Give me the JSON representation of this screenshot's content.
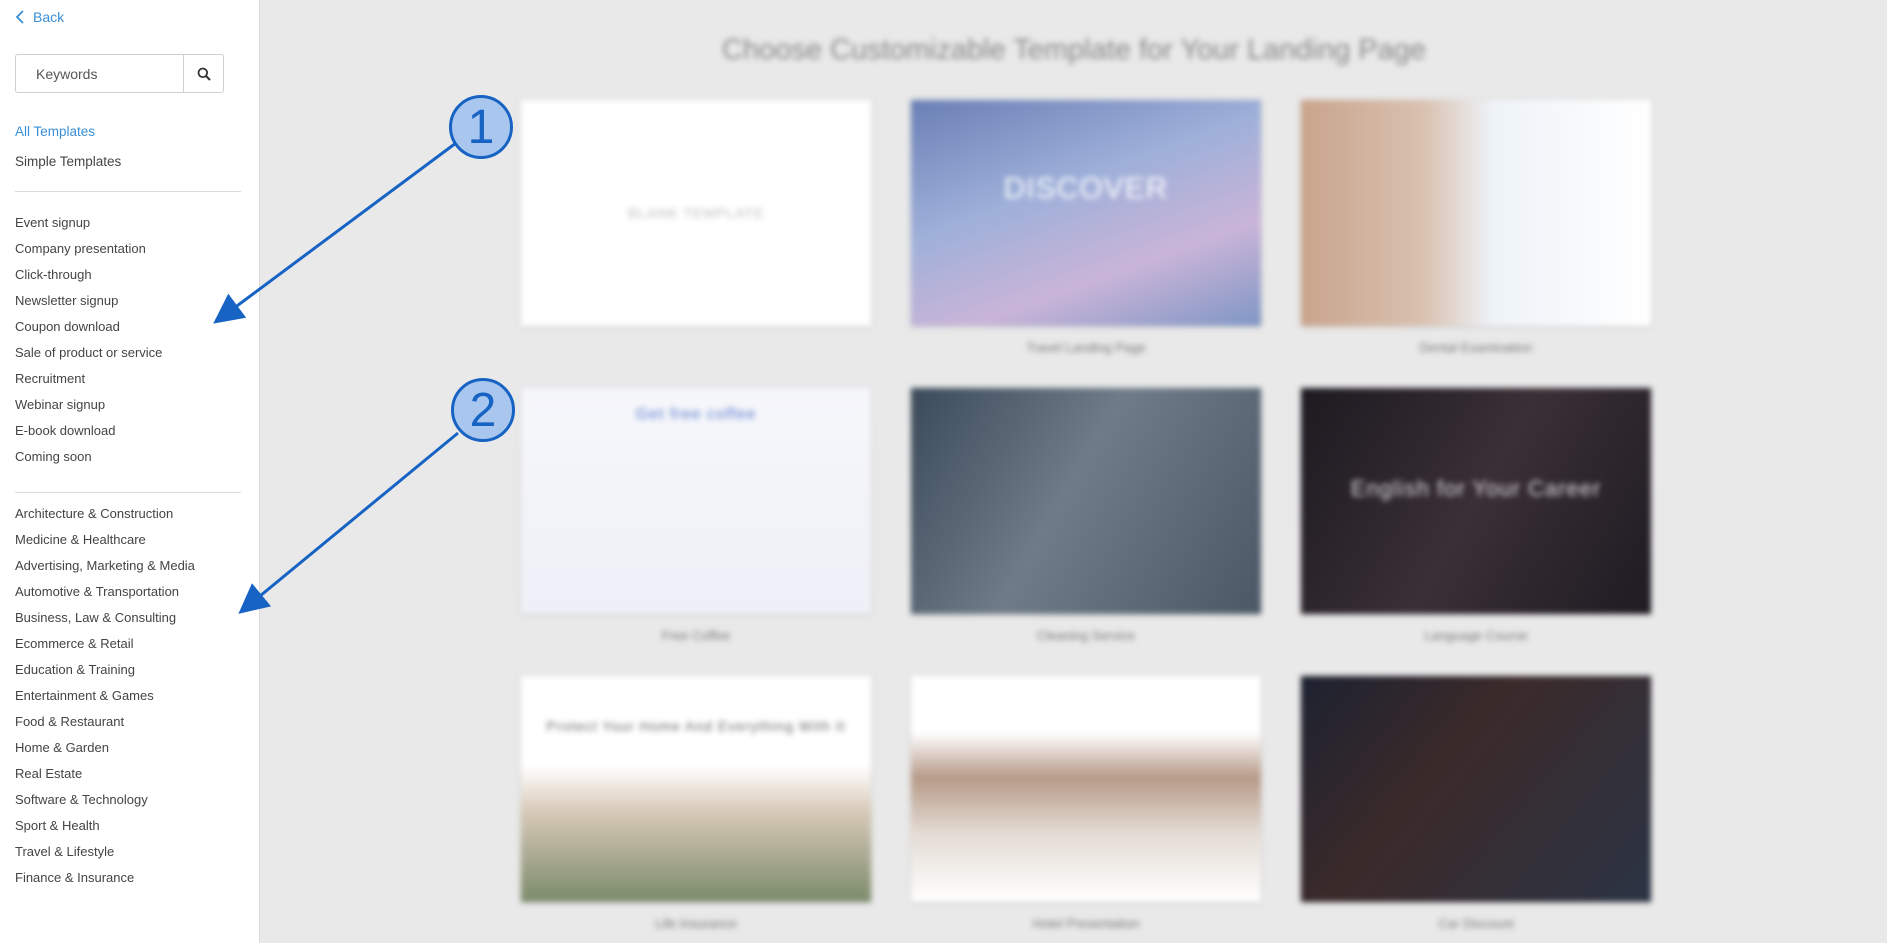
{
  "sidebar": {
    "back_label": "Back",
    "search": {
      "placeholder": "Keywords"
    },
    "primary": [
      "All Templates",
      "Simple Templates"
    ],
    "goals": [
      "Event signup",
      "Company presentation",
      "Click-through",
      "Newsletter signup",
      "Coupon download",
      "Sale of product or service",
      "Recruitment",
      "Webinar signup",
      "E-book download",
      "Coming soon"
    ],
    "industries": [
      "Architecture & Construction",
      "Medicine & Healthcare",
      "Advertising, Marketing & Media",
      "Automotive & Transportation",
      "Business, Law & Consulting",
      "Ecommerce & Retail",
      "Education & Training",
      "Entertainment & Games",
      "Food & Restaurant",
      "Home & Garden",
      "Real Estate",
      "Software & Technology",
      "Sport & Health",
      "Travel & Lifestyle",
      "Finance & Insurance"
    ]
  },
  "main": {
    "title": "Choose Customizable Template for Your Landing Page",
    "cards": [
      {
        "label": "",
        "inner": "BLANK TEMPLATE"
      },
      {
        "label": "Travel Landing Page",
        "inner": "DISCOVER"
      },
      {
        "label": "Dental Examination",
        "inner": ""
      },
      {
        "label": "Free Coffee",
        "inner": "Get free coffee"
      },
      {
        "label": "Cleaning Service",
        "inner": ""
      },
      {
        "label": "Language Course",
        "inner": "English for Your Career"
      },
      {
        "label": "Life Insurance",
        "inner": "Protect Your Home And Everything With It"
      },
      {
        "label": "Hotel Presentation",
        "inner": ""
      },
      {
        "label": "Car Discount",
        "inner": ""
      }
    ]
  },
  "annotations": {
    "badge1": "1",
    "badge2": "2"
  },
  "colors": {
    "accent": "#3a8fd6",
    "annotation": "#1763c4",
    "badge_fill": "#a8c6ee"
  }
}
